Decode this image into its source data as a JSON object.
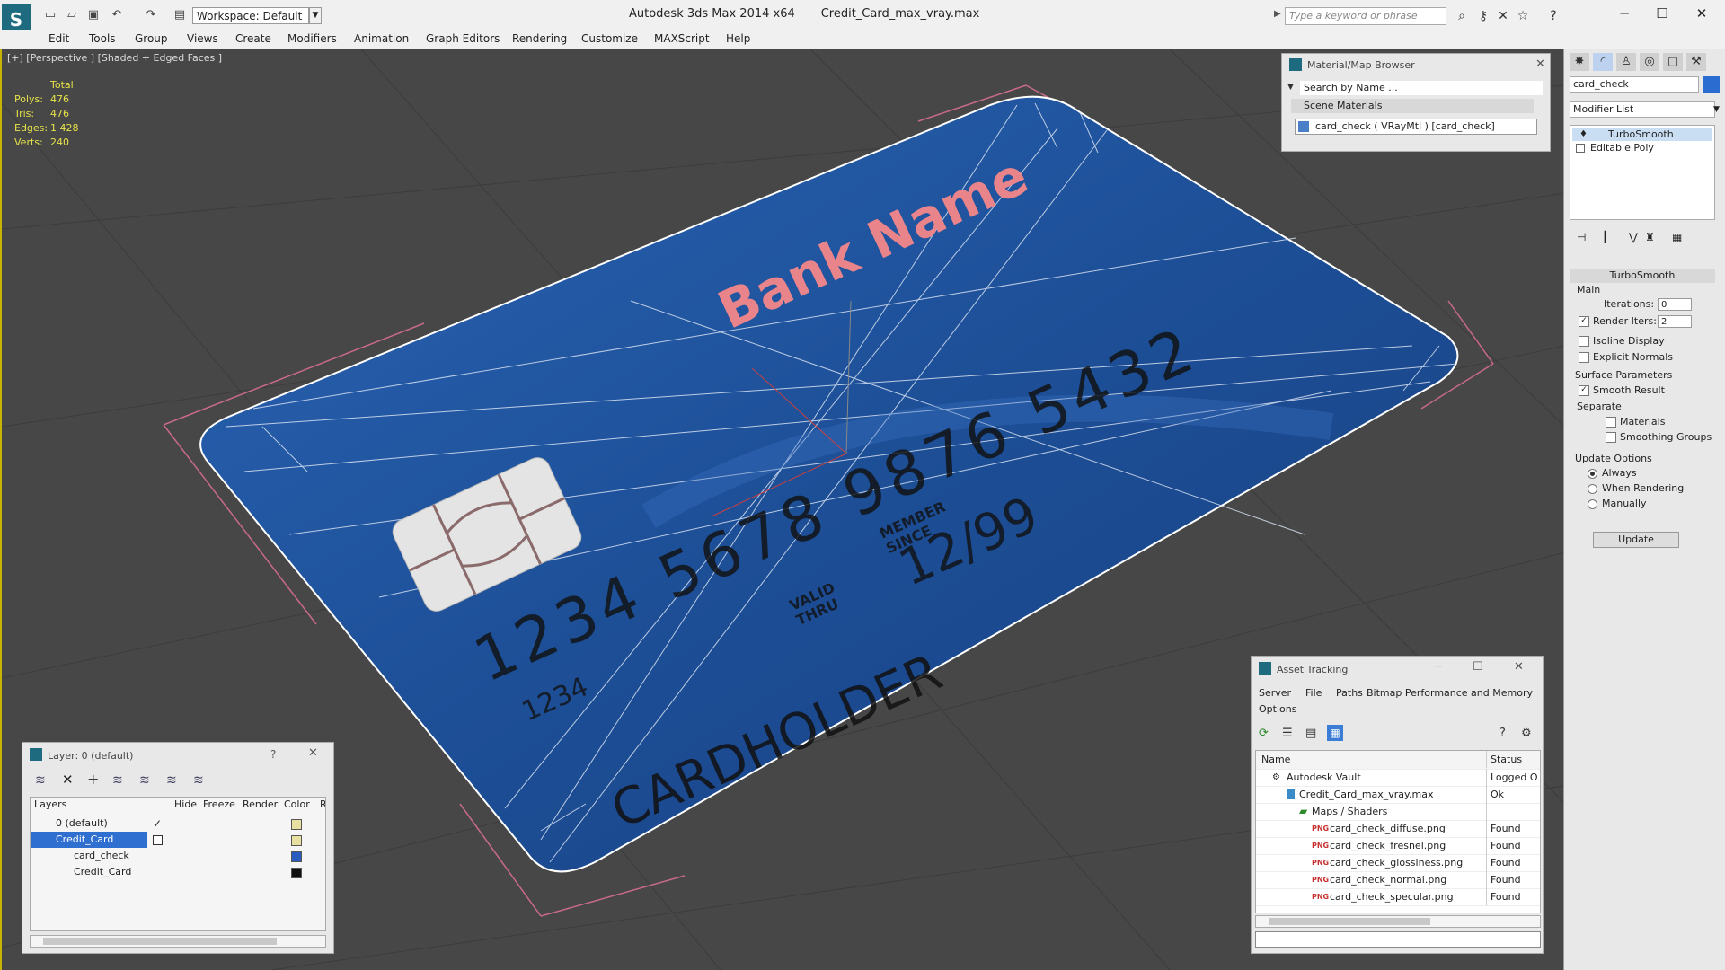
{
  "title_bar": {
    "app_title": "Autodesk 3ds Max  2014 x64",
    "file_name": "Credit_Card_max_vray.max",
    "workspace": "Workspace: Default",
    "search_placeholder": "Type a keyword or phrase"
  },
  "menu": [
    "Edit",
    "Tools",
    "Group",
    "Views",
    "Create",
    "Modifiers",
    "Animation",
    "Graph Editors",
    "Rendering",
    "Customize",
    "MAXScript",
    "Help"
  ],
  "viewport": {
    "label": "[+] [Perspective ] [Shaded + Edged Faces ]",
    "stats": {
      "total_label": "Total",
      "rows": [
        {
          "label": "Polys:",
          "value": "476"
        },
        {
          "label": "Tris:",
          "value": "476"
        },
        {
          "label": "Edges:",
          "value": "1 428"
        },
        {
          "label": "Verts:",
          "value": "240"
        }
      ]
    },
    "card": {
      "bank_name": "Bank Name",
      "number": "1234  5678  9876  5432",
      "small_number": "1234",
      "valid_label": "VALID\nTHRU",
      "member_label": "MEMBER\nSINCE",
      "expiry": "12/99",
      "holder": "CARDHOLDER",
      "card_color": "#1e4f96",
      "bank_color": "#e9848a"
    }
  },
  "command_panel": {
    "object_name": "card_check",
    "object_color": "#2a6cd0",
    "modifier_list": "Modifier List",
    "stack": [
      "TurboSmooth",
      "Editable Poly"
    ],
    "turbosmooth": {
      "title": "TurboSmooth",
      "main_label": "Main",
      "iterations_label": "Iterations:",
      "iterations": "0",
      "render_iters_label": "Render Iters:",
      "render_iters": "2",
      "isoline": "Isoline Display",
      "explicit_normals": "Explicit Normals",
      "surface_label": "Surface Parameters",
      "smooth_result": "Smooth Result",
      "separate_label": "Separate",
      "materials": "Materials",
      "smoothing_groups": "Smoothing Groups",
      "update_options": "Update Options",
      "always": "Always",
      "when_rendering": "When Rendering",
      "manually": "Manually",
      "update_btn": "Update"
    }
  },
  "material_browser": {
    "title": "Material/Map Browser",
    "search_placeholder": "Search by Name ...",
    "section": "Scene Materials",
    "item": "card_check  ( VRayMtl ) [card_check]"
  },
  "layer_dialog": {
    "title": "Layer: 0 (default)",
    "help": "?",
    "columns": [
      "Layers",
      "Hide",
      "Freeze",
      "Render",
      "Color",
      "R"
    ],
    "rows": [
      {
        "name": "0 (default)",
        "color": "#e8e0a0"
      },
      {
        "name": "Credit_Card",
        "color": "#e8e0a0"
      },
      {
        "name": "card_check",
        "color": "#2a5cc0"
      },
      {
        "name": "Credit_Card",
        "color": "#111111"
      }
    ]
  },
  "asset_tracking": {
    "title": "Asset Tracking",
    "menu": [
      "Server",
      "File",
      "Paths",
      "Bitmap Performance and Memory",
      "Options"
    ],
    "columns": [
      "Name",
      "Status"
    ],
    "rows": [
      {
        "name": "Autodesk Vault",
        "status": "Logged O"
      },
      {
        "name": "Credit_Card_max_vray.max",
        "status": "Ok"
      },
      {
        "name": "Maps / Shaders",
        "status": ""
      },
      {
        "name": "card_check_diffuse.png",
        "status": "Found"
      },
      {
        "name": "card_check_fresnel.png",
        "status": "Found"
      },
      {
        "name": "card_check_glossiness.png",
        "status": "Found"
      },
      {
        "name": "card_check_normal.png",
        "status": "Found"
      },
      {
        "name": "card_check_specular.png",
        "status": "Found"
      }
    ]
  }
}
